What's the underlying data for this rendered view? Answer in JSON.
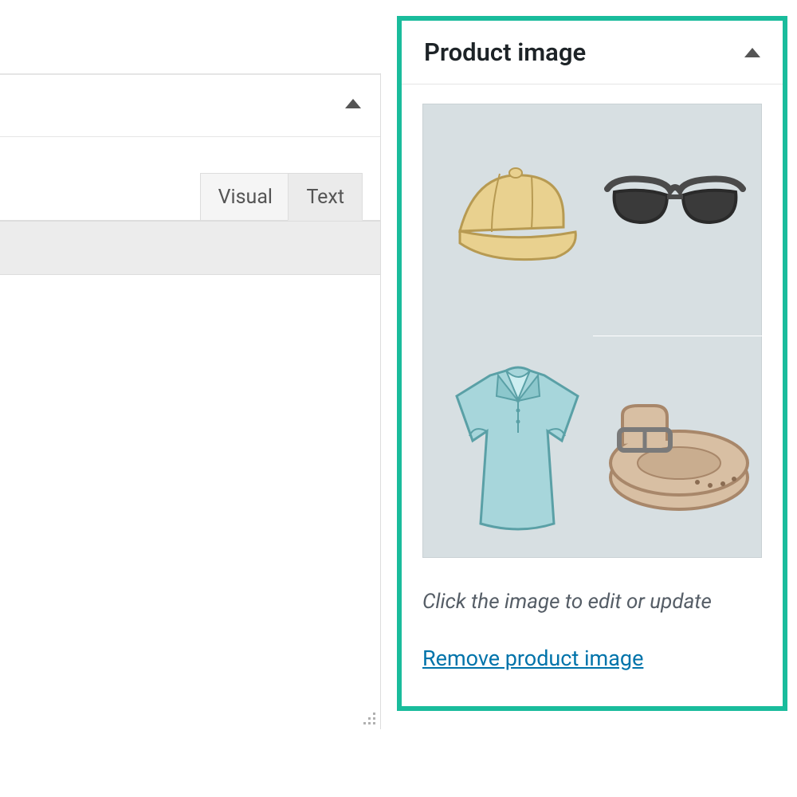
{
  "editor": {
    "tabs": {
      "visual": "Visual",
      "text": "Text"
    }
  },
  "sidebar": {
    "product_image": {
      "title": "Product image",
      "help": "Click the image to edit or update",
      "remove_label": "Remove product image",
      "items": [
        "cap",
        "sunglasses",
        "polo-shirt",
        "belt"
      ]
    }
  }
}
